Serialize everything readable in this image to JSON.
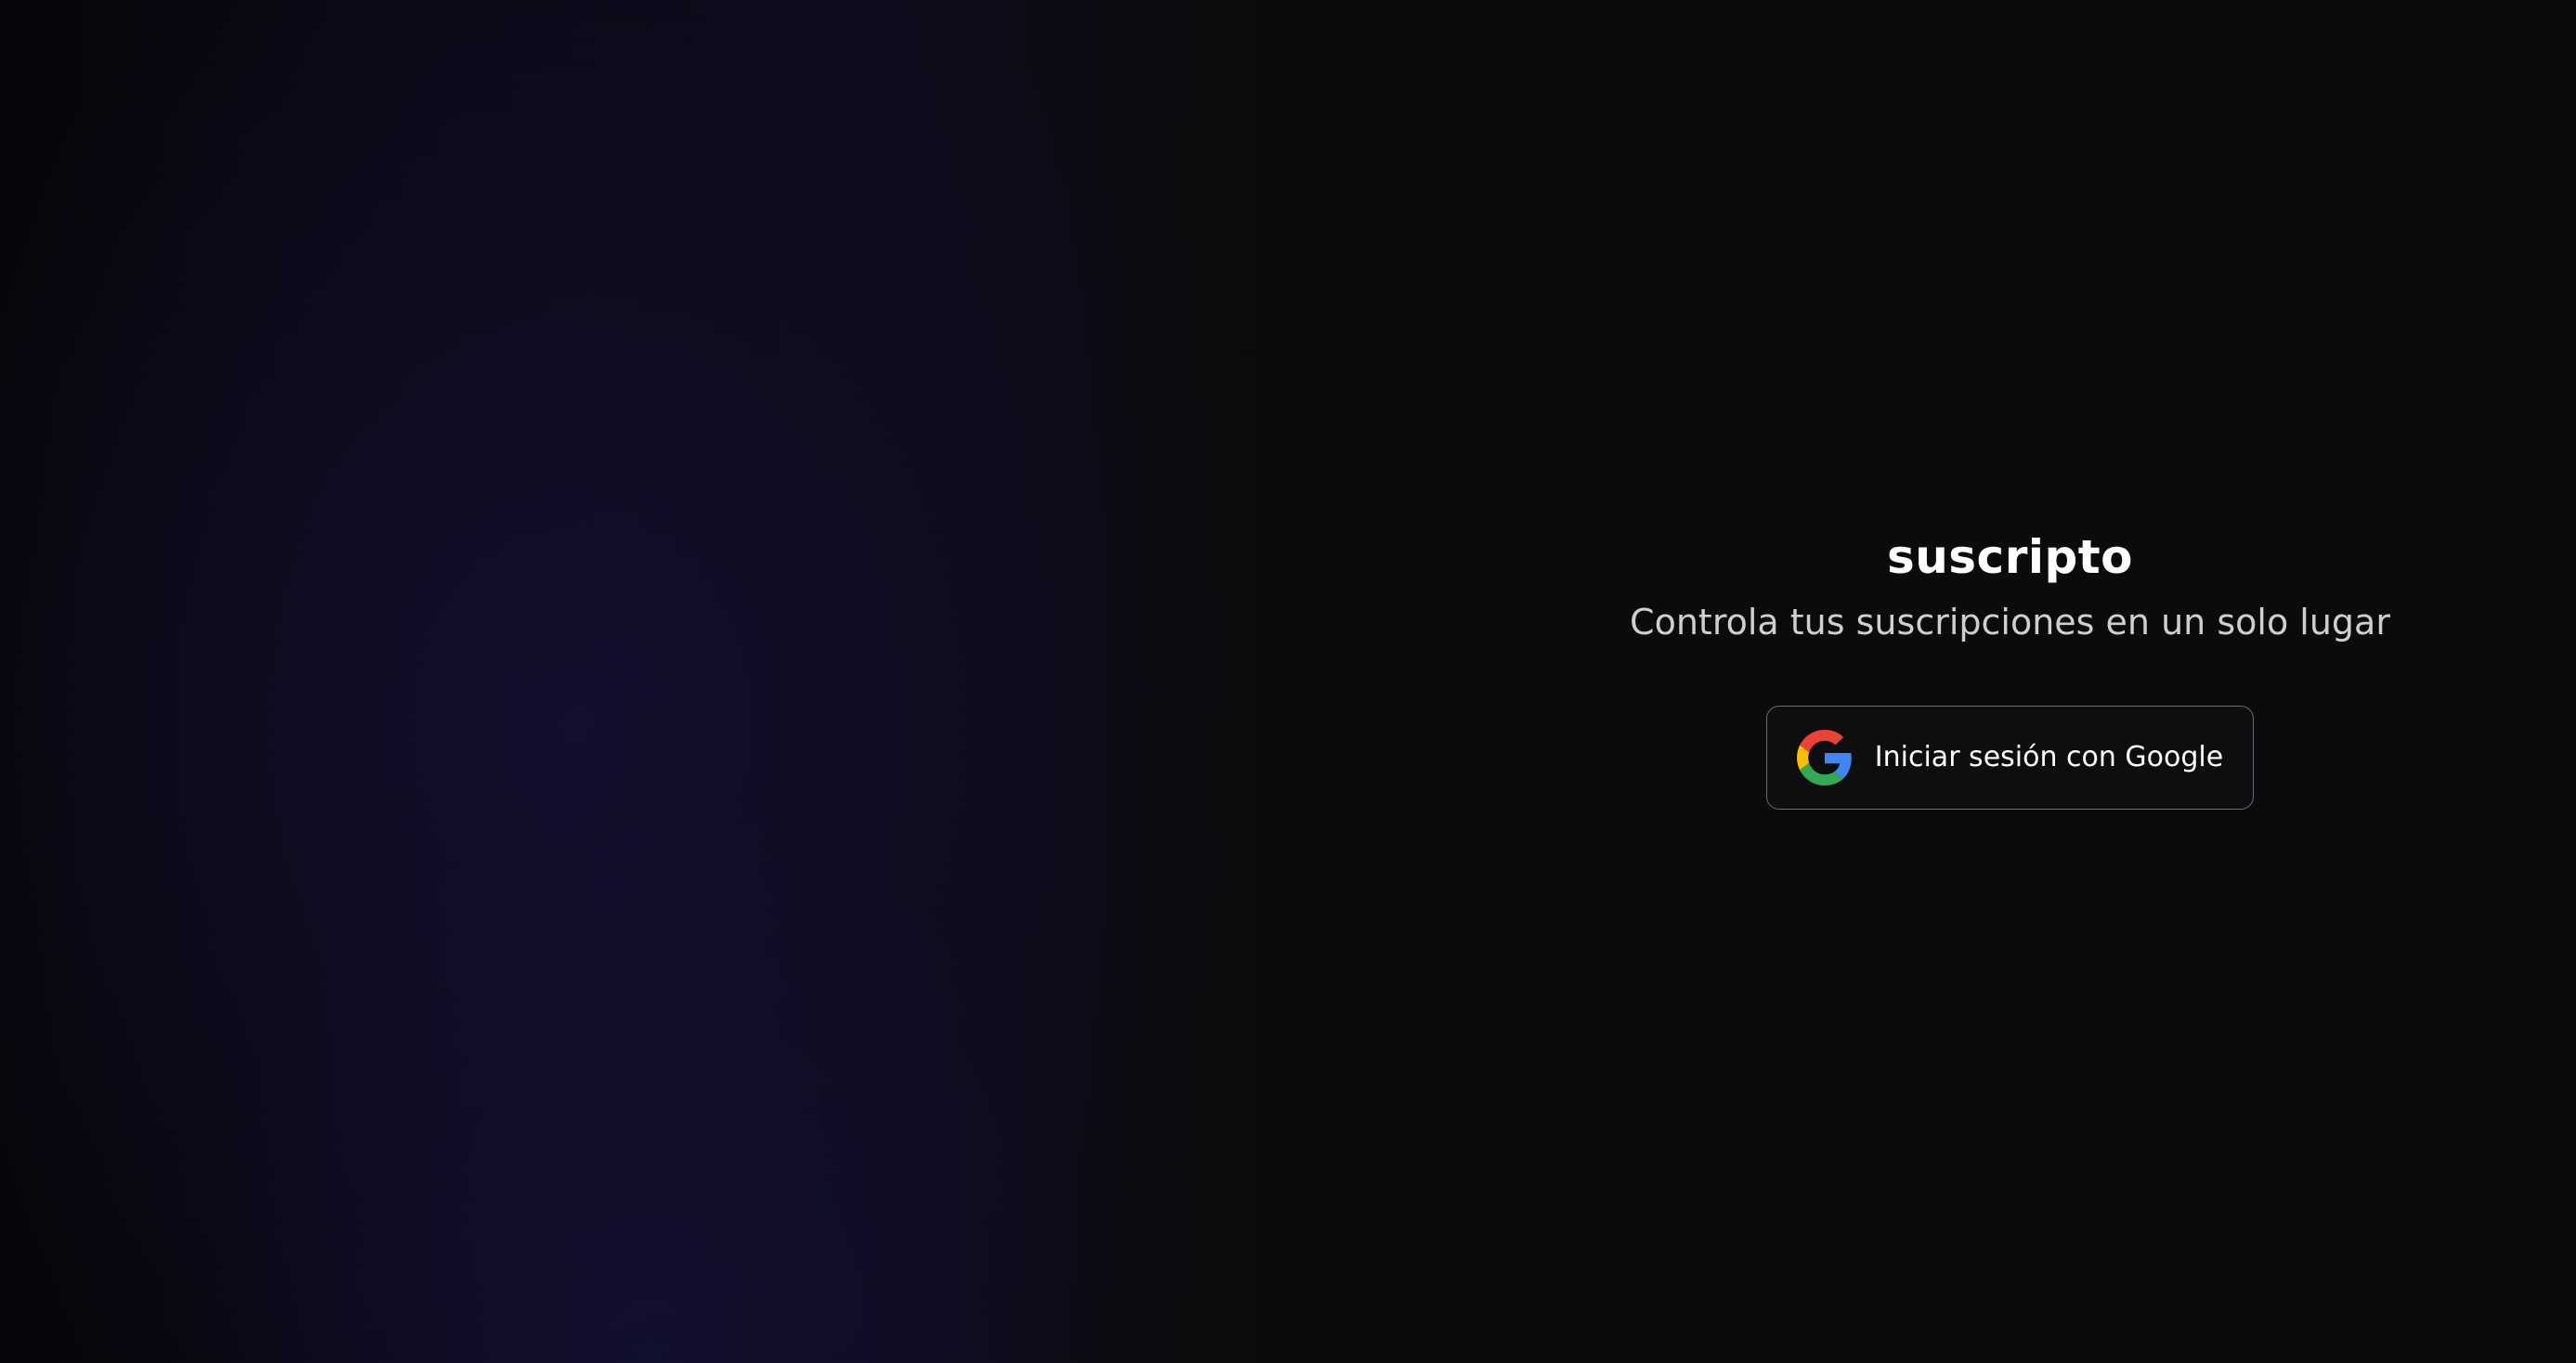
{
  "app": {
    "brand": "suscripto",
    "tagline": "Controla tus suscripciones en un solo lugar"
  },
  "login": {
    "google_button_label": "Iniciar sesión con Google",
    "google_icon": "google-icon"
  },
  "colors": {
    "background": "#0b0b0c",
    "hero_tint": "#0e0c24",
    "button_border": "#6c6c74",
    "text_primary": "#ffffff",
    "text_secondary": "#cfcfd2"
  }
}
